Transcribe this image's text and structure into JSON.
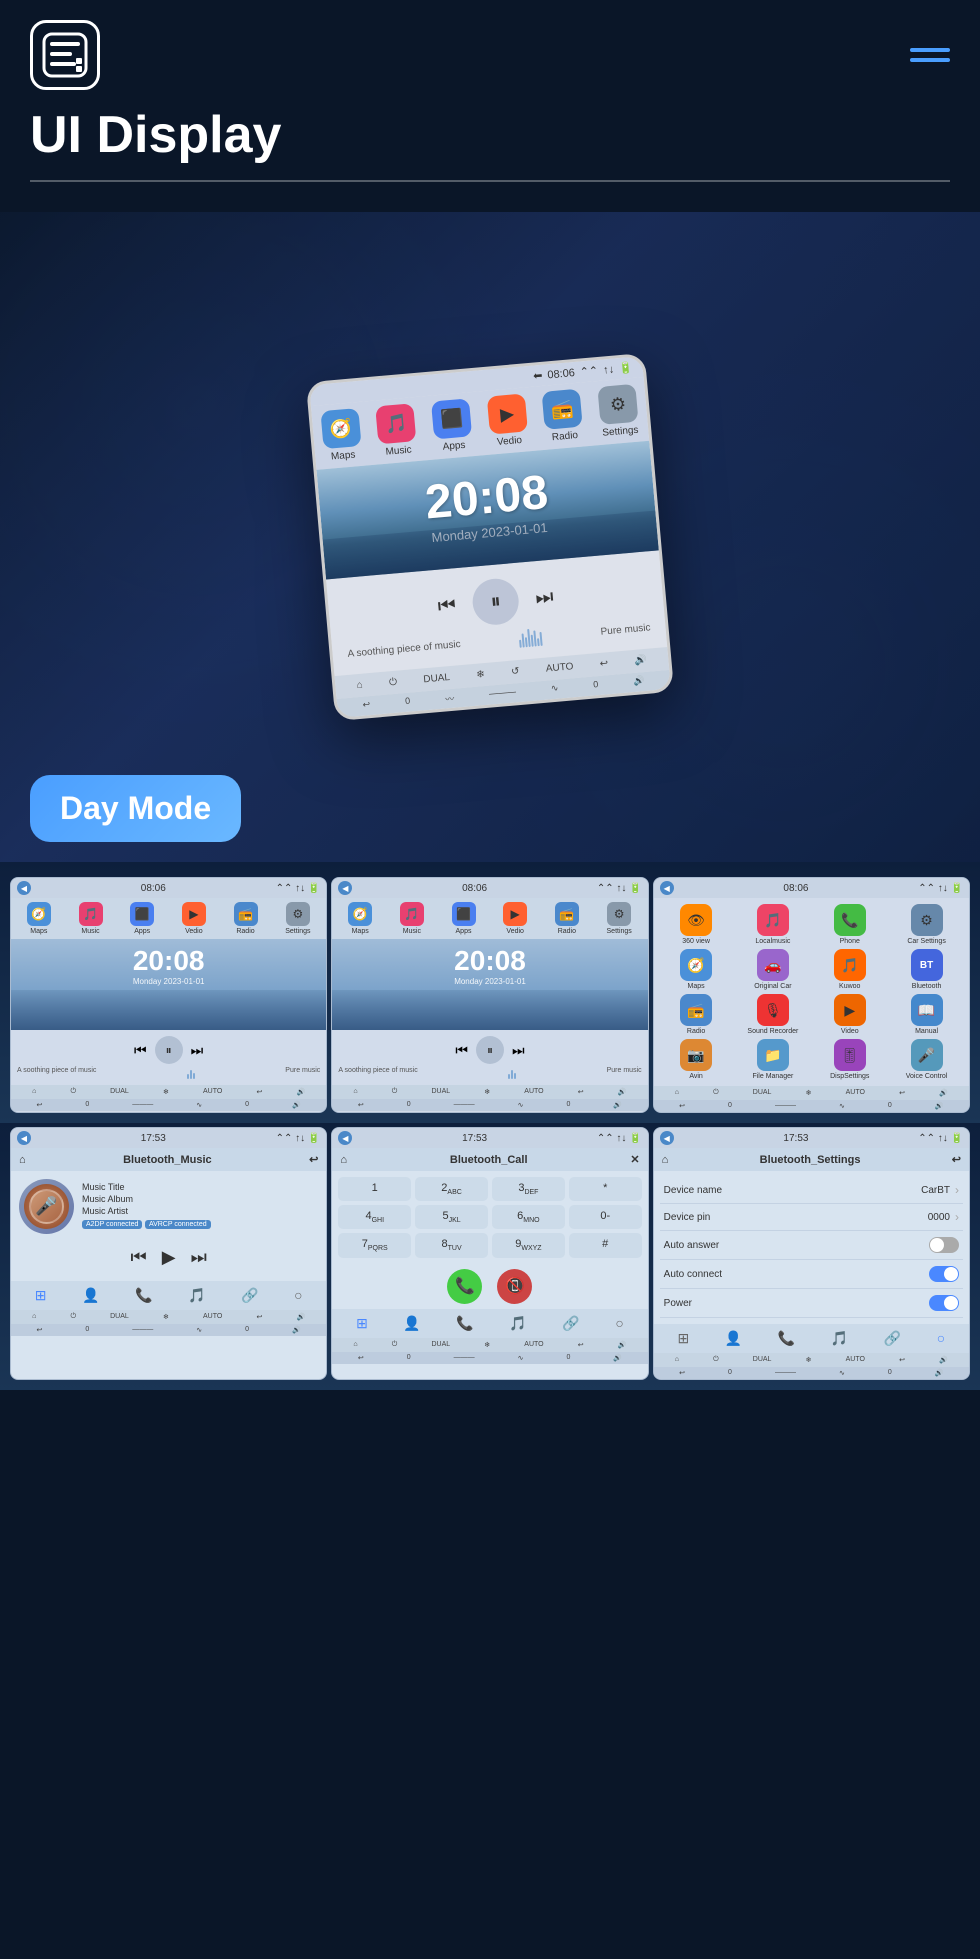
{
  "header": {
    "title": "UI Display",
    "menu_label": "menu"
  },
  "hero": {
    "phone": {
      "time": "20:08",
      "date": "Monday  2023-01-01",
      "status_time": "08:06",
      "nav_items": [
        {
          "label": "Maps",
          "color": "#4a90d9",
          "icon": "🧭"
        },
        {
          "label": "Music",
          "color": "#e84070",
          "icon": "🎵"
        },
        {
          "label": "Apps",
          "color": "#4a7ff0",
          "icon": "⬛"
        },
        {
          "label": "Vedio",
          "color": "#ff6030",
          "icon": "▶"
        },
        {
          "label": "Radio",
          "color": "#4a88cc",
          "icon": "📻"
        },
        {
          "label": "Settings",
          "color": "#8899aa",
          "icon": "⚙"
        }
      ],
      "music_text": "A soothing piece of music",
      "music_right": "Pure music"
    },
    "day_mode_label": "Day Mode"
  },
  "grid_row1": {
    "screens": [
      {
        "id": "screen1",
        "status_time": "08:06",
        "time": "20:08",
        "date": "Monday  2023-01-01",
        "music_left": "A soothing piece of music",
        "music_right": "Pure music"
      },
      {
        "id": "screen2",
        "status_time": "08:06",
        "time": "20:08",
        "date": "Monday  2023-01-01",
        "music_left": "A soothing piece of music",
        "music_right": "Pure music"
      },
      {
        "id": "screen3",
        "status_time": "08:06",
        "type": "apps",
        "apps": [
          {
            "label": "360 view",
            "icon": "👁",
            "color": "#ff8800"
          },
          {
            "label": "Localmusic",
            "icon": "🎵",
            "color": "#ee4466"
          },
          {
            "label": "Phone",
            "icon": "📞",
            "color": "#44bb44"
          },
          {
            "label": "Car Settings",
            "icon": "⚙",
            "color": "#6688aa"
          },
          {
            "label": "Maps",
            "icon": "🧭",
            "color": "#4a90d9"
          },
          {
            "label": "Original Car",
            "icon": "🚗",
            "color": "#9966cc"
          },
          {
            "label": "Kuwoo",
            "icon": "🎵",
            "color": "#ff6600"
          },
          {
            "label": "Bluetooth",
            "icon": "📶",
            "color": "#4466dd"
          },
          {
            "label": "Radio",
            "icon": "📻",
            "color": "#4a88cc"
          },
          {
            "label": "Sound Recorder",
            "icon": "🎙",
            "color": "#ee3333"
          },
          {
            "label": "Video",
            "icon": "▶",
            "color": "#ee6600"
          },
          {
            "label": "Manual",
            "icon": "📖",
            "color": "#4488cc"
          },
          {
            "label": "Avin",
            "icon": "📷",
            "color": "#dd8833"
          },
          {
            "label": "File Manager",
            "icon": "📁",
            "color": "#5599cc"
          },
          {
            "label": "DispSettings",
            "icon": "🎚",
            "color": "#9944bb"
          },
          {
            "label": "Voice Control",
            "icon": "🎤",
            "color": "#5599bb"
          }
        ]
      }
    ]
  },
  "grid_row2": {
    "screens": [
      {
        "id": "bt_music",
        "title": "Bluetooth_Music",
        "status_time": "17:53",
        "music_title": "Music Title",
        "music_album": "Music Album",
        "music_artist": "Music Artist",
        "badge1": "A2DP connected",
        "badge2": "AVRCP connected"
      },
      {
        "id": "bt_call",
        "title": "Bluetooth_Call",
        "status_time": "17:53",
        "dialpad": [
          "1",
          "2ABC",
          "3DEF",
          "*",
          "4GHI",
          "5JKL",
          "6MNO",
          "0-",
          "7PQRS",
          "8TUV",
          "9WXYZ",
          "#"
        ]
      },
      {
        "id": "bt_settings",
        "title": "Bluetooth_Settings",
        "status_time": "17:53",
        "settings": [
          {
            "label": "Device name",
            "value": "CarBT",
            "type": "chevron"
          },
          {
            "label": "Device pin",
            "value": "0000",
            "type": "chevron"
          },
          {
            "label": "Auto answer",
            "value": "",
            "type": "toggle_off"
          },
          {
            "label": "Auto connect",
            "value": "",
            "type": "toggle_on"
          },
          {
            "label": "Power",
            "value": "",
            "type": "toggle_on"
          }
        ]
      }
    ]
  },
  "nav_items": [
    "Maps",
    "Music",
    "Apps",
    "Vedio",
    "Radio",
    "Settings"
  ],
  "bottom_bar_items": [
    "⌂",
    "⏻",
    "DUAL",
    "❄",
    "↺",
    "AUTO",
    "↩",
    "🔊"
  ],
  "bt_music_controls": [
    "⏮",
    "⏸",
    "⏭"
  ],
  "bt_music_controls2": [
    "⏮",
    "▶",
    "⏭"
  ]
}
